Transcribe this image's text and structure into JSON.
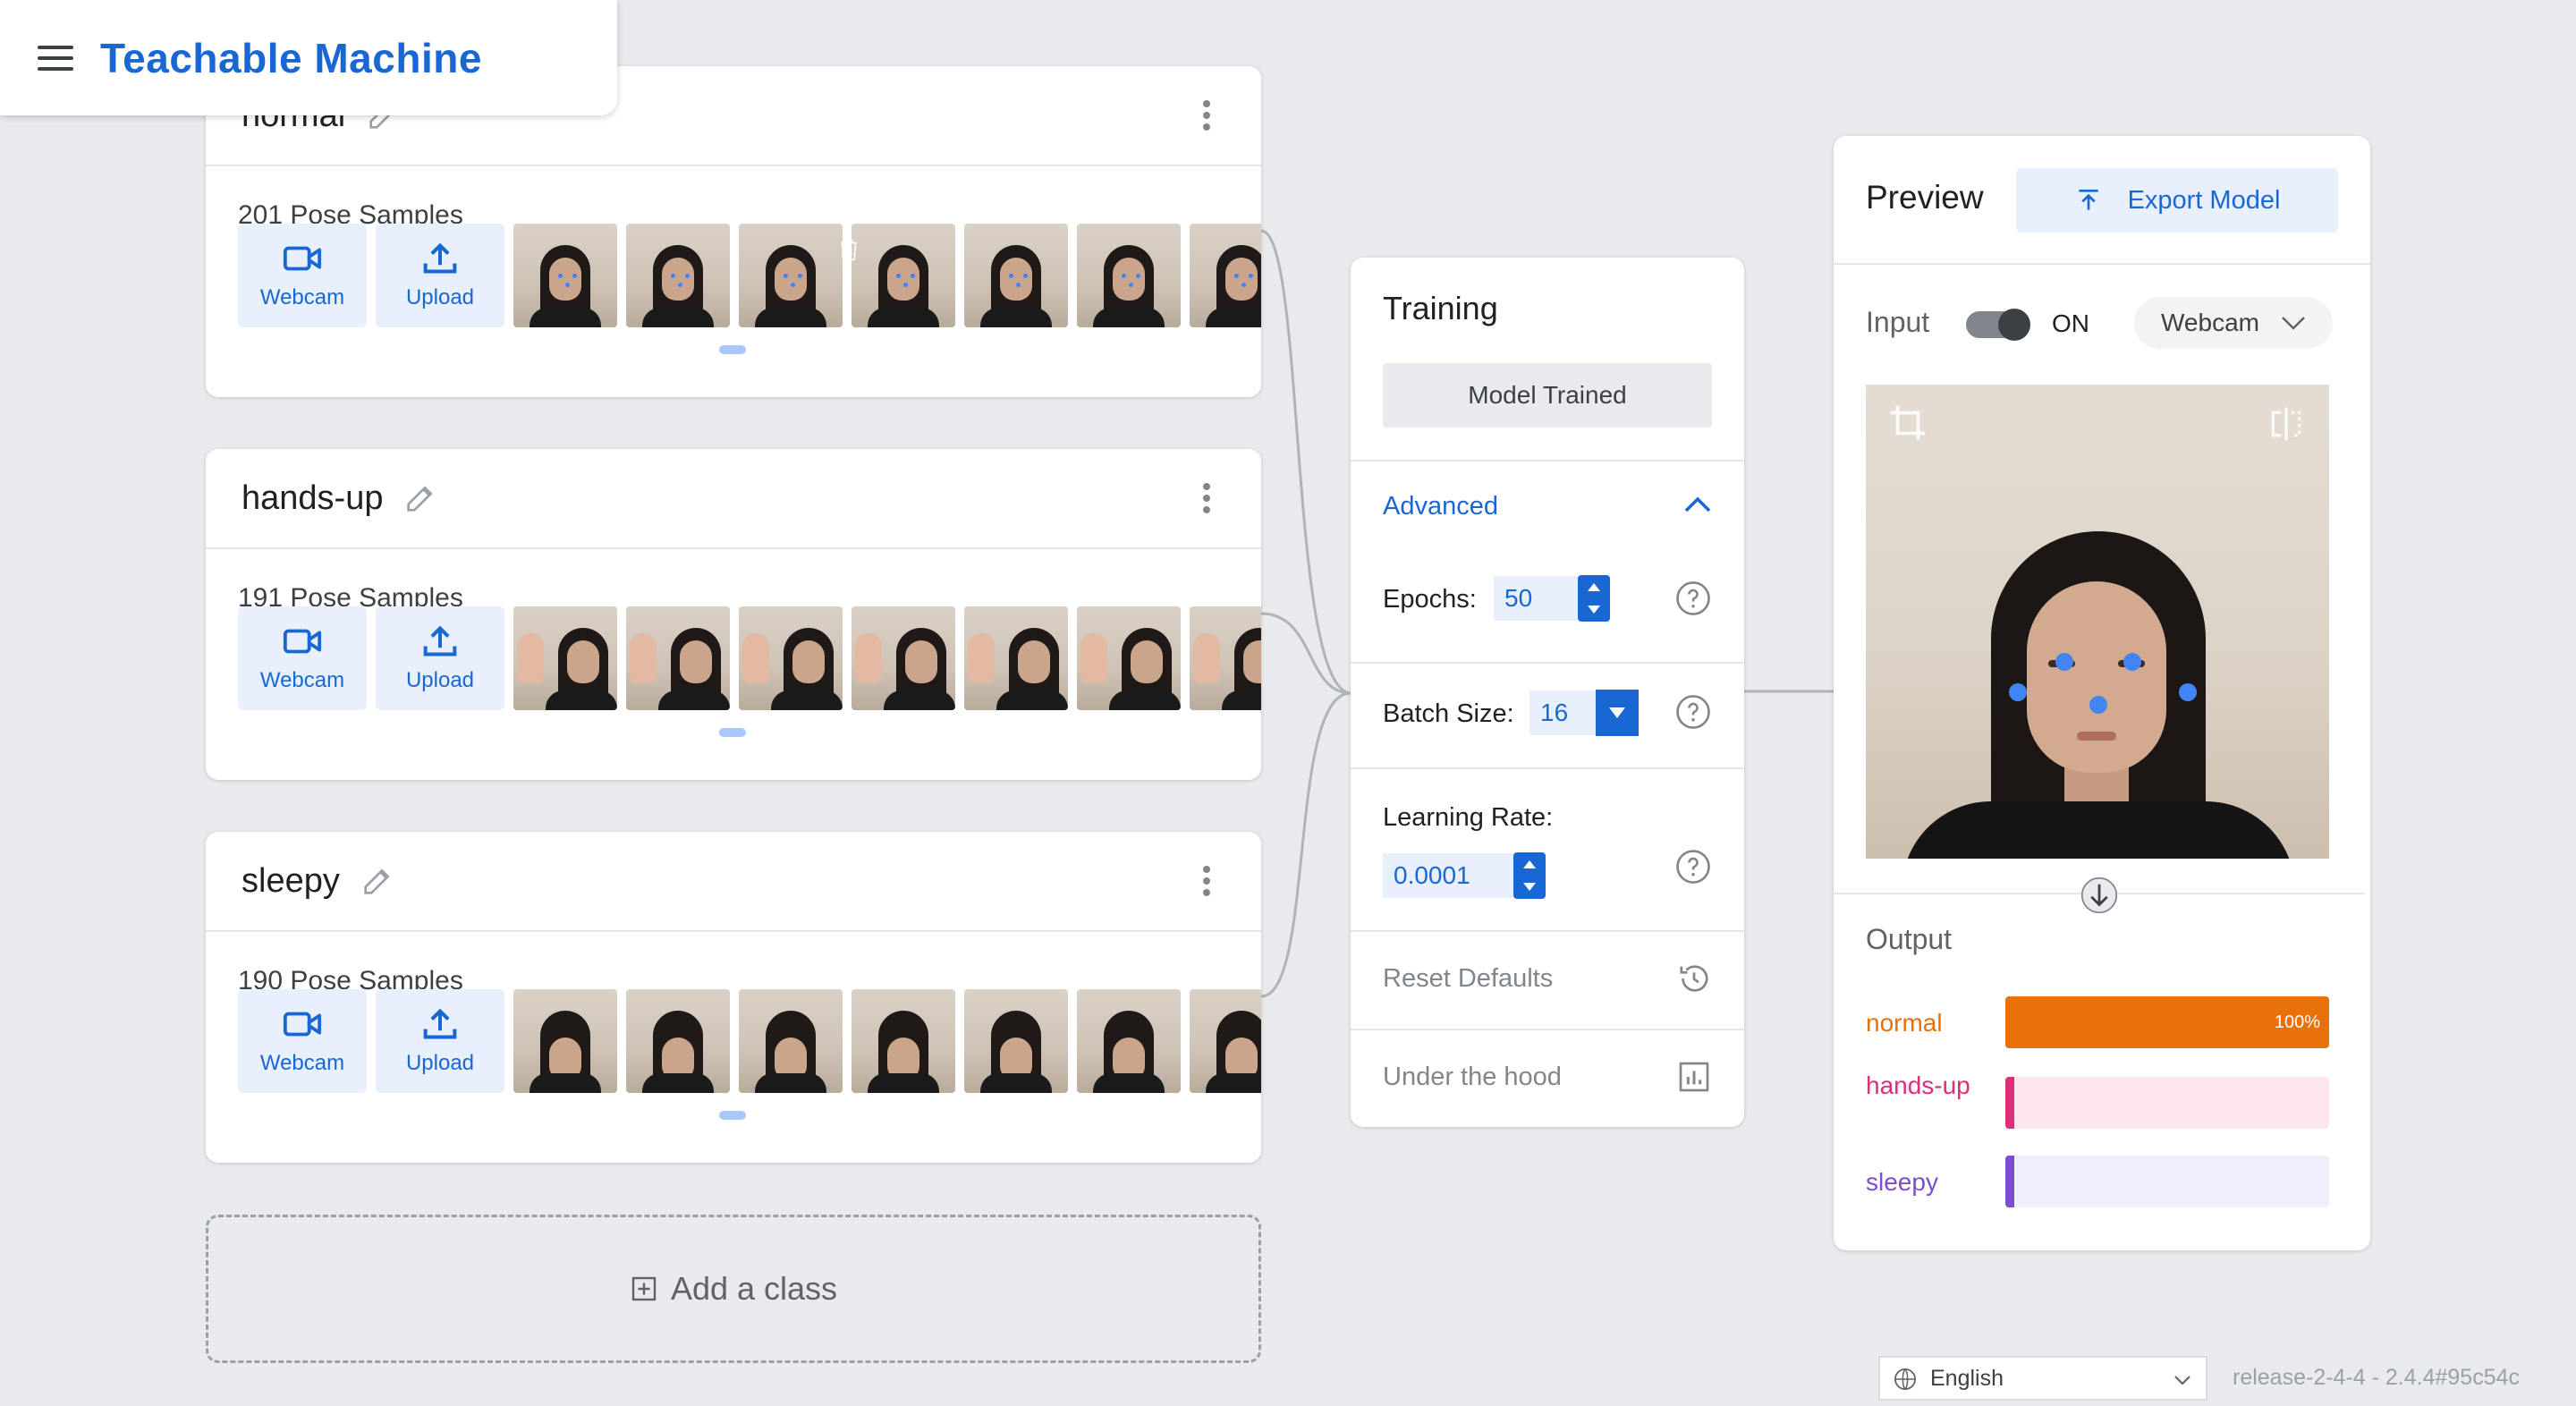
{
  "app": {
    "title": "Teachable Machine"
  },
  "classes": [
    {
      "name": "normal",
      "sample_count": "201 Pose Samples",
      "webcam_label": "Webcam",
      "upload_label": "Upload"
    },
    {
      "name": "hands-up",
      "sample_count": "191 Pose Samples",
      "webcam_label": "Webcam",
      "upload_label": "Upload"
    },
    {
      "name": "sleepy",
      "sample_count": "190 Pose Samples",
      "webcam_label": "Webcam",
      "upload_label": "Upload"
    }
  ],
  "add_class": {
    "label": "Add a class"
  },
  "training": {
    "title": "Training",
    "status_button": "Model Trained",
    "advanced_label": "Advanced",
    "epochs": {
      "label": "Epochs:",
      "value": "50"
    },
    "batch_size": {
      "label": "Batch Size:",
      "value": "16"
    },
    "learning_rate": {
      "label": "Learning Rate:",
      "value": "0.0001"
    },
    "reset_label": "Reset Defaults",
    "under_hood_label": "Under the hood"
  },
  "preview": {
    "title": "Preview",
    "export_label": "Export Model",
    "input_label": "Input",
    "toggle_state": "ON",
    "source": "Webcam",
    "output_label": "Output",
    "outputs": [
      {
        "label": "normal",
        "percent": 100,
        "percent_label": "100%",
        "color": "#e8710a",
        "track": "#fce8d8"
      },
      {
        "label": "hands-up",
        "percent": 0,
        "percent_label": "",
        "color": "#d93077",
        "track": "#fde7ec"
      },
      {
        "label": "sleepy",
        "percent": 0,
        "percent_label": "",
        "color": "#7c4dcf",
        "track": "#efeffc"
      }
    ]
  },
  "footer": {
    "language": "English",
    "version": "release-2-4-4 - 2.4.4#95c54c"
  },
  "colors": {
    "accent": "#1967d2",
    "background": "#e8eaed"
  }
}
